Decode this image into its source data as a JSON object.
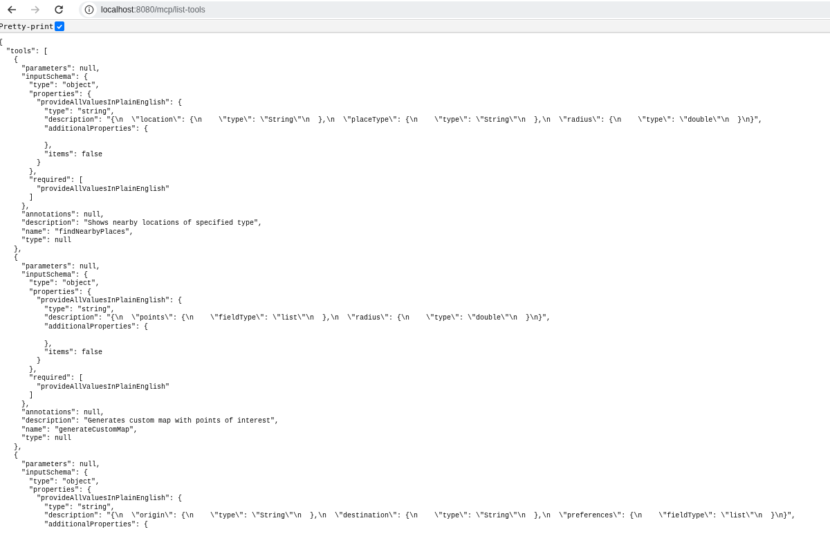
{
  "toolbar": {
    "back": {
      "disabled": false
    },
    "forward": {
      "disabled": true
    },
    "address": {
      "host": "localhost",
      "path": ":8080/mcp/list-tools"
    }
  },
  "pretty_print": {
    "label": "Pretty-print",
    "checked": true
  },
  "json_view": [
    {
      "text": "{",
      "children": [
        {
          "text": "\"tools\": [",
          "children": [
            {
              "text": "{",
              "children": [
                {
                  "text": "\"parameters\": null,"
                },
                {
                  "text": "\"inputSchema\": {",
                  "children": [
                    {
                      "text": "\"type\": \"object\","
                    },
                    {
                      "text": "\"properties\": {",
                      "children": [
                        {
                          "text": "\"provideAllValuesInPlainEnglish\": {",
                          "children": [
                            {
                              "text": "\"type\": \"string\","
                            },
                            {
                              "text": "\"description\": \"{\\n  \\\"location\\\": {\\n    \\\"type\\\": \\\"String\\\"\\n  },\\n  \\\"placeType\\\": {\\n    \\\"type\\\": \\\"String\\\"\\n  },\\n  \\\"radius\\\": {\\n    \\\"type\\\": \\\"double\\\"\\n  }\\n}\","
                            },
                            {
                              "text": "\"additionalProperties\": {",
                              "children": [
                                {
                                  "kind": "blank"
                                }
                              ]
                            },
                            {
                              "text": "},"
                            },
                            {
                              "text": "\"items\": false"
                            }
                          ]
                        },
                        {
                          "text": "}"
                        }
                      ]
                    },
                    {
                      "text": "},"
                    },
                    {
                      "text": "\"required\": [",
                      "children": [
                        {
                          "text": "\"provideAllValuesInPlainEnglish\""
                        }
                      ]
                    },
                    {
                      "text": "]"
                    }
                  ]
                },
                {
                  "text": "},"
                },
                {
                  "text": "\"annotations\": null,"
                },
                {
                  "text": "\"description\": \"Shows nearby locations of specified type\","
                },
                {
                  "text": "\"name\": \"findNearbyPlaces\","
                },
                {
                  "text": "\"type\": null"
                }
              ]
            },
            {
              "text": "},"
            },
            {
              "text": "{",
              "children": [
                {
                  "text": "\"parameters\": null,"
                },
                {
                  "text": "\"inputSchema\": {",
                  "children": [
                    {
                      "text": "\"type\": \"object\","
                    },
                    {
                      "text": "\"properties\": {",
                      "children": [
                        {
                          "text": "\"provideAllValuesInPlainEnglish\": {",
                          "children": [
                            {
                              "text": "\"type\": \"string\","
                            },
                            {
                              "text": "\"description\": \"{\\n  \\\"points\\\": {\\n    \\\"fieldType\\\": \\\"list\\\"\\n  },\\n  \\\"radius\\\": {\\n    \\\"type\\\": \\\"double\\\"\\n  }\\n}\","
                            },
                            {
                              "text": "\"additionalProperties\": {",
                              "children": [
                                {
                                  "kind": "blank"
                                }
                              ]
                            },
                            {
                              "text": "},"
                            },
                            {
                              "text": "\"items\": false"
                            }
                          ]
                        },
                        {
                          "text": "}"
                        }
                      ]
                    },
                    {
                      "text": "},"
                    },
                    {
                      "text": "\"required\": [",
                      "children": [
                        {
                          "text": "\"provideAllValuesInPlainEnglish\""
                        }
                      ]
                    },
                    {
                      "text": "]"
                    }
                  ]
                },
                {
                  "text": "},"
                },
                {
                  "text": "\"annotations\": null,"
                },
                {
                  "text": "\"description\": \"Generates custom map with points of interest\","
                },
                {
                  "text": "\"name\": \"generateCustomMap\","
                },
                {
                  "text": "\"type\": null"
                }
              ]
            },
            {
              "text": "},"
            },
            {
              "text": "{",
              "children": [
                {
                  "text": "\"parameters\": null,"
                },
                {
                  "text": "\"inputSchema\": {",
                  "children": [
                    {
                      "text": "\"type\": \"object\","
                    },
                    {
                      "text": "\"properties\": {",
                      "children": [
                        {
                          "text": "\"provideAllValuesInPlainEnglish\": {",
                          "children": [
                            {
                              "text": "\"type\": \"string\","
                            },
                            {
                              "text": "\"description\": \"{\\n  \\\"origin\\\": {\\n    \\\"type\\\": \\\"String\\\"\\n  },\\n  \\\"destination\\\": {\\n    \\\"type\\\": \\\"String\\\"\\n  },\\n  \\\"preferences\\\": {\\n    \\\"fieldType\\\": \\\"list\\\"\\n  }\\n}\","
                            },
                            {
                              "text": "\"additionalProperties\": {"
                            }
                          ]
                        }
                      ]
                    }
                  ]
                }
              ]
            }
          ]
        }
      ]
    }
  ]
}
